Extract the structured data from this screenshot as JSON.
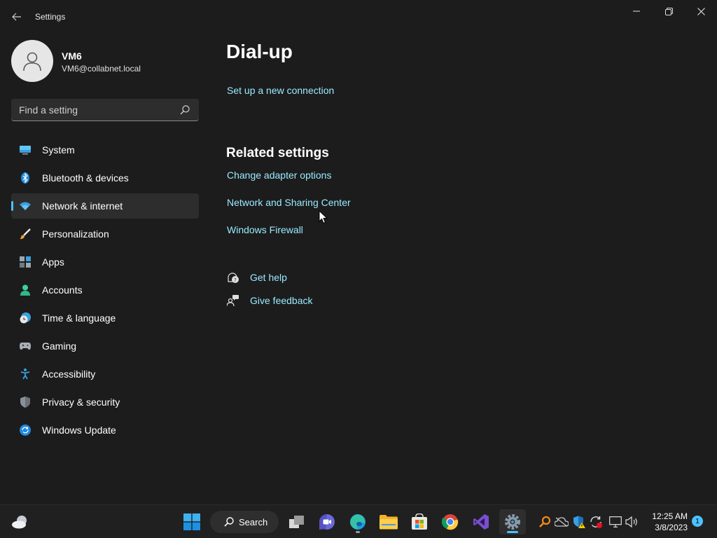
{
  "window": {
    "title": "Settings",
    "back_icon": "back-arrow-icon",
    "controls": [
      "minimize-icon",
      "restore-icon",
      "close-icon"
    ]
  },
  "profile": {
    "name": "VM6",
    "email": "VM6@collabnet.local"
  },
  "search": {
    "placeholder": "Find a setting"
  },
  "sidebar": {
    "items": [
      {
        "label": "System",
        "icon": "system-icon"
      },
      {
        "label": "Bluetooth & devices",
        "icon": "bluetooth-icon"
      },
      {
        "label": "Network & internet",
        "icon": "wifi-icon",
        "selected": true
      },
      {
        "label": "Personalization",
        "icon": "brush-icon"
      },
      {
        "label": "Apps",
        "icon": "apps-icon"
      },
      {
        "label": "Accounts",
        "icon": "accounts-icon"
      },
      {
        "label": "Time & language",
        "icon": "clock-globe-icon"
      },
      {
        "label": "Gaming",
        "icon": "gamepad-icon"
      },
      {
        "label": "Accessibility",
        "icon": "accessibility-icon"
      },
      {
        "label": "Privacy & security",
        "icon": "shield-icon"
      },
      {
        "label": "Windows Update",
        "icon": "update-icon"
      }
    ]
  },
  "main": {
    "title": "Dial-up",
    "setup_link": "Set up a new connection",
    "related": {
      "heading": "Related settings",
      "links": [
        "Change adapter options",
        "Network and Sharing Center",
        "Windows Firewall"
      ]
    },
    "help": {
      "get_help": "Get help",
      "give_feedback": "Give feedback"
    }
  },
  "taskbar": {
    "search_label": "Search",
    "pinned": [
      "task-view-icon",
      "teams-chat-icon",
      "edge-icon",
      "file-explorer-icon",
      "store-icon",
      "chrome-icon",
      "visual-studio-icon",
      "settings-icon"
    ],
    "tray": [
      "search-tool-icon",
      "onedrive-icon",
      "security-icon",
      "sync-icon",
      "network-icon",
      "volume-icon"
    ],
    "time": "12:25 AM",
    "date": "3/8/2023",
    "notification_count": "1"
  },
  "colors": {
    "background": "#1c1c1c",
    "accent": "#4cc2ff",
    "link": "#99ebff",
    "selected_item": "#2d2d2d",
    "taskbar": "#202020"
  }
}
